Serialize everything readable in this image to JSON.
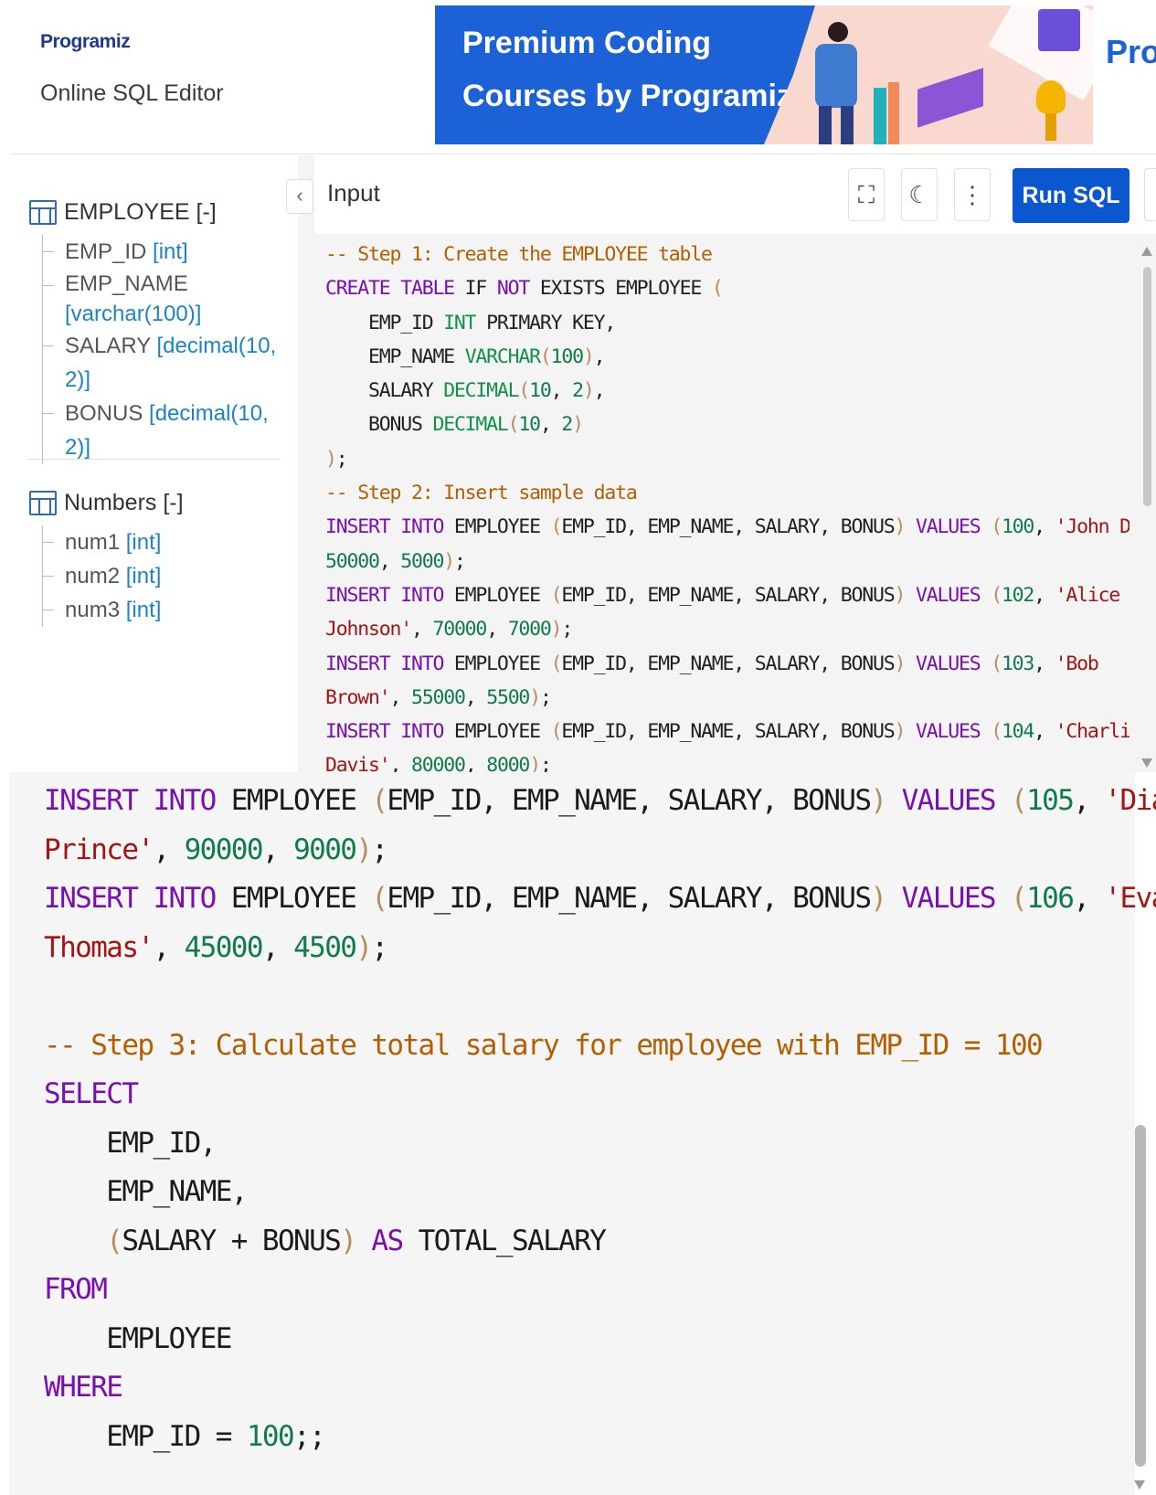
{
  "header": {
    "logo": "Programiz",
    "subtitle": "Online SQL Editor",
    "banner_line1": "Premium Coding",
    "banner_line2": "Courses by Programiz",
    "banner_edge": "Prog"
  },
  "sidebar": {
    "tables": [
      {
        "name": "EMPLOYEE [-]",
        "columns": [
          {
            "name": "EMP_ID",
            "type": "[int]"
          },
          {
            "name": "EMP_NAME",
            "type": "[varchar(100)]"
          },
          {
            "name": "SALARY",
            "type": "[decimal(10, 2)]"
          },
          {
            "name": "BONUS",
            "type": "[decimal(10, 2)]"
          }
        ]
      },
      {
        "name": "Numbers [-]",
        "columns": [
          {
            "name": "num1",
            "type": "[int]"
          },
          {
            "name": "num2",
            "type": "[int]"
          },
          {
            "name": "num3",
            "type": "[int]"
          }
        ]
      }
    ]
  },
  "editor": {
    "tab_label": "Input",
    "run_label": "Run SQL",
    "collapse_icon": "chevron-left-icon",
    "toolbar_icons": [
      "fullscreen-icon",
      "moon-icon",
      "more-vertical-icon"
    ],
    "code_top": [
      [
        [
          "cm",
          "-- Step 1: Create the EMPLOYEE table"
        ]
      ],
      [
        [
          "kw",
          "CREATE TABLE"
        ],
        [
          "",
          " IF "
        ],
        [
          "kw",
          "NOT"
        ],
        [
          "",
          " EXISTS EMPLOYEE "
        ],
        [
          "pn",
          "("
        ]
      ],
      [
        [
          "",
          "    EMP_ID "
        ],
        [
          "ty",
          "INT"
        ],
        [
          "",
          " PRIMARY KEY,"
        ]
      ],
      [
        [
          "",
          "    EMP_NAME "
        ],
        [
          "ty",
          "VARCHAR"
        ],
        [
          "pn",
          "("
        ],
        [
          "nm",
          "100"
        ],
        [
          "pn",
          ")"
        ],
        [
          "",
          ","
        ]
      ],
      [
        [
          "",
          "    SALARY "
        ],
        [
          "ty",
          "DECIMAL"
        ],
        [
          "pn",
          "("
        ],
        [
          "nm",
          "10"
        ],
        [
          "",
          ", "
        ],
        [
          "nm",
          "2"
        ],
        [
          "pn",
          ")"
        ],
        [
          "",
          ","
        ]
      ],
      [
        [
          "",
          "    BONUS "
        ],
        [
          "ty",
          "DECIMAL"
        ],
        [
          "pn",
          "("
        ],
        [
          "nm",
          "10"
        ],
        [
          "",
          ", "
        ],
        [
          "nm",
          "2"
        ],
        [
          "pn",
          ")"
        ]
      ],
      [
        [
          "pn",
          ")"
        ],
        [
          "",
          ";"
        ]
      ],
      [
        [
          "cm",
          "-- Step 2: Insert sample data"
        ]
      ],
      [
        [
          "kw",
          "INSERT INTO"
        ],
        [
          "",
          " EMPLOYEE "
        ],
        [
          "pn",
          "("
        ],
        [
          "",
          "EMP_ID, EMP_NAME, SALARY, BONUS"
        ],
        [
          "pn",
          ")"
        ],
        [
          "",
          " "
        ],
        [
          "kw",
          "VALUES"
        ],
        [
          "",
          " "
        ],
        [
          "pn",
          "("
        ],
        [
          "nm",
          "100"
        ],
        [
          "",
          ", "
        ],
        [
          "st",
          "'John Doe'"
        ],
        [
          "",
          ","
        ]
      ],
      [
        [
          "nm",
          "50000"
        ],
        [
          "",
          ", "
        ],
        [
          "nm",
          "5000"
        ],
        [
          "pn",
          ")"
        ],
        [
          "",
          ";"
        ]
      ],
      [
        [
          "kw",
          "INSERT INTO"
        ],
        [
          "",
          " EMPLOYEE "
        ],
        [
          "pn",
          "("
        ],
        [
          "",
          "EMP_ID, EMP_NAME, SALARY, BONUS"
        ],
        [
          "pn",
          ")"
        ],
        [
          "",
          " "
        ],
        [
          "kw",
          "VALUES"
        ],
        [
          "",
          " "
        ],
        [
          "pn",
          "("
        ],
        [
          "nm",
          "102"
        ],
        [
          "",
          ", "
        ],
        [
          "st",
          "'Alice"
        ]
      ],
      [
        [
          "st",
          "Johnson'"
        ],
        [
          "",
          ", "
        ],
        [
          "nm",
          "70000"
        ],
        [
          "",
          ", "
        ],
        [
          "nm",
          "7000"
        ],
        [
          "pn",
          ")"
        ],
        [
          "",
          ";"
        ]
      ],
      [
        [
          "kw",
          "INSERT INTO"
        ],
        [
          "",
          " EMPLOYEE "
        ],
        [
          "pn",
          "("
        ],
        [
          "",
          "EMP_ID, EMP_NAME, SALARY, BONUS"
        ],
        [
          "pn",
          ")"
        ],
        [
          "",
          " "
        ],
        [
          "kw",
          "VALUES"
        ],
        [
          "",
          " "
        ],
        [
          "pn",
          "("
        ],
        [
          "nm",
          "103"
        ],
        [
          "",
          ", "
        ],
        [
          "st",
          "'Bob"
        ]
      ],
      [
        [
          "st",
          "Brown'"
        ],
        [
          "",
          ", "
        ],
        [
          "nm",
          "55000"
        ],
        [
          "",
          ", "
        ],
        [
          "nm",
          "5500"
        ],
        [
          "pn",
          ")"
        ],
        [
          "",
          ";"
        ]
      ],
      [
        [
          "kw",
          "INSERT INTO"
        ],
        [
          "",
          " EMPLOYEE "
        ],
        [
          "pn",
          "("
        ],
        [
          "",
          "EMP_ID, EMP_NAME, SALARY, BONUS"
        ],
        [
          "pn",
          ")"
        ],
        [
          "",
          " "
        ],
        [
          "kw",
          "VALUES"
        ],
        [
          "",
          " "
        ],
        [
          "pn",
          "("
        ],
        [
          "nm",
          "104"
        ],
        [
          "",
          ", "
        ],
        [
          "st",
          "'Charlie"
        ]
      ],
      [
        [
          "st",
          "Davis'"
        ],
        [
          "",
          ", "
        ],
        [
          "nm",
          "80000"
        ],
        [
          "",
          ", "
        ],
        [
          "nm",
          "8000"
        ],
        [
          "pn",
          ")"
        ],
        [
          "",
          ";"
        ]
      ]
    ],
    "code_zoom": [
      [
        [
          "kw",
          "INSERT INTO"
        ],
        [
          "",
          " EMPLOYEE "
        ],
        [
          "pn",
          "("
        ],
        [
          "",
          "EMP_ID, EMP_NAME, SALARY, BONUS"
        ],
        [
          "pn",
          ")"
        ],
        [
          "",
          " "
        ],
        [
          "kw",
          "VALUES"
        ],
        [
          "",
          " "
        ],
        [
          "pn",
          "("
        ],
        [
          "nm",
          "105"
        ],
        [
          "",
          ", "
        ],
        [
          "st",
          "'Diana"
        ]
      ],
      [
        [
          "st",
          "Prince'"
        ],
        [
          "",
          ", "
        ],
        [
          "nm",
          "90000"
        ],
        [
          "",
          ", "
        ],
        [
          "nm",
          "9000"
        ],
        [
          "pn",
          ")"
        ],
        [
          "",
          ";"
        ]
      ],
      [
        [
          "kw",
          "INSERT INTO"
        ],
        [
          "",
          " EMPLOYEE "
        ],
        [
          "pn",
          "("
        ],
        [
          "",
          "EMP_ID, EMP_NAME, SALARY, BONUS"
        ],
        [
          "pn",
          ")"
        ],
        [
          "",
          " "
        ],
        [
          "kw",
          "VALUES"
        ],
        [
          "",
          " "
        ],
        [
          "pn",
          "("
        ],
        [
          "nm",
          "106"
        ],
        [
          "",
          ", "
        ],
        [
          "st",
          "'Evan"
        ]
      ],
      [
        [
          "st",
          "Thomas'"
        ],
        [
          "",
          ", "
        ],
        [
          "nm",
          "45000"
        ],
        [
          "",
          ", "
        ],
        [
          "nm",
          "4500"
        ],
        [
          "pn",
          ")"
        ],
        [
          "",
          ";"
        ]
      ],
      [],
      [
        [
          "cm",
          "-- Step 3: Calculate total salary for employee with EMP_ID = 100"
        ]
      ],
      [
        [
          "kw",
          "SELECT"
        ]
      ],
      [
        [
          "",
          "    EMP_ID,"
        ]
      ],
      [
        [
          "",
          "    EMP_NAME,"
        ]
      ],
      [
        [
          "",
          "    "
        ],
        [
          "pn",
          "("
        ],
        [
          "",
          "SALARY + BONUS"
        ],
        [
          "pn",
          ")"
        ],
        [
          "",
          " "
        ],
        [
          "kw",
          "AS"
        ],
        [
          "",
          " TOTAL_SALARY"
        ]
      ],
      [
        [
          "kw",
          "FROM"
        ]
      ],
      [
        [
          "",
          "    EMPLOYEE"
        ]
      ],
      [
        [
          "kw",
          "WHERE"
        ]
      ],
      [
        [
          "",
          "    EMP_ID = "
        ],
        [
          "nm",
          "100"
        ],
        [
          "",
          ";;"
        ]
      ]
    ]
  }
}
